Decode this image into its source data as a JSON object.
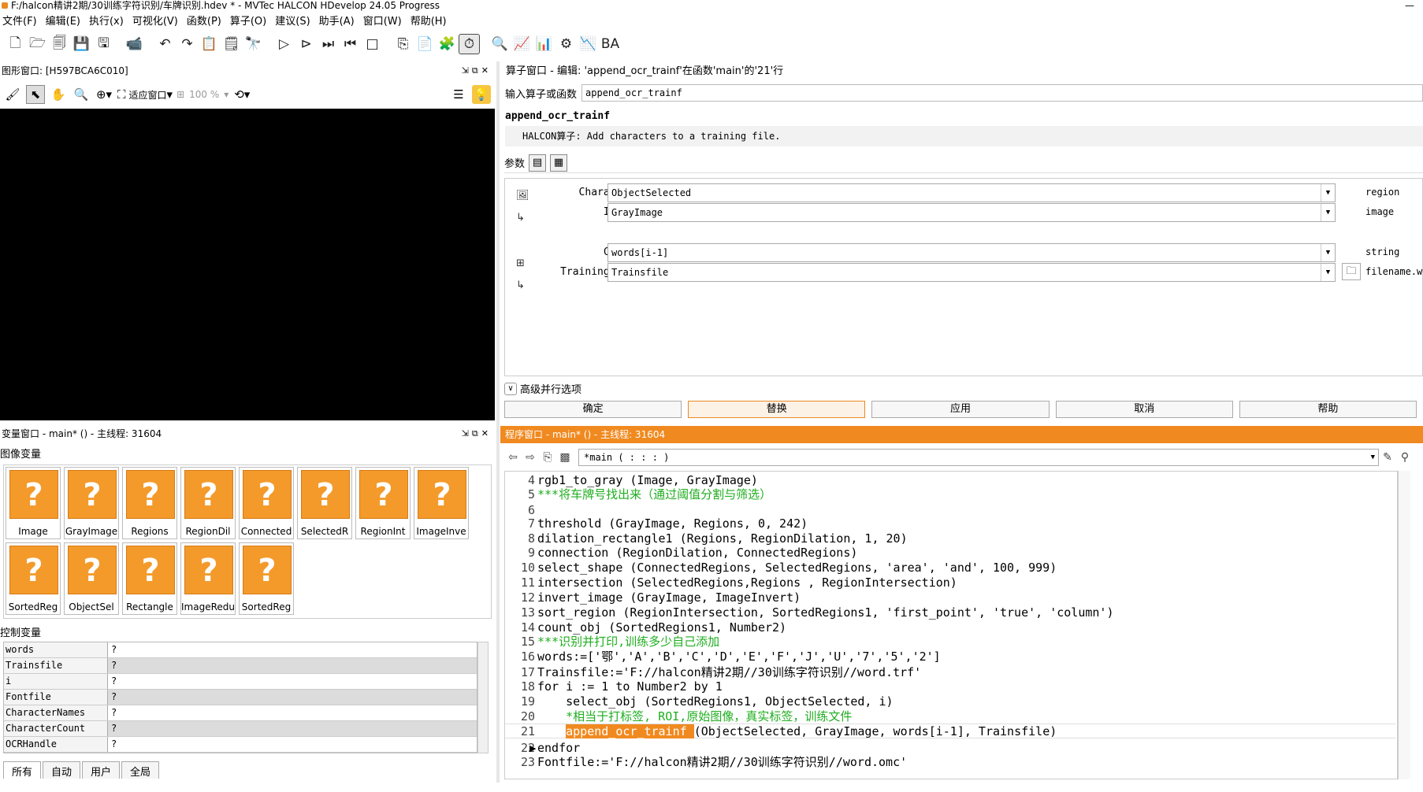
{
  "window": {
    "title": "F:/halcon精讲2期/30训练字符识别/车牌识别.hdev * - MVTec HALCON HDevelop 24.05 Progress",
    "minimize": "—"
  },
  "menu": [
    "文件(F)",
    "编辑(E)",
    "执行(x)",
    "可视化(V)",
    "函数(P)",
    "算子(O)",
    "建议(S)",
    "助手(A)",
    "窗口(W)",
    "帮助(H)"
  ],
  "graphics": {
    "header": "图形窗口: [H597BCA6C010]",
    "zoom_fit": "适应窗口",
    "zoom_pct": "100 %"
  },
  "variables": {
    "header": "变量窗口 - main* () - 主线程: 31604",
    "iconic_label": "图像变量",
    "iconic": [
      "Image",
      "GrayImage",
      "Regions",
      "RegionDil",
      "Connected",
      "SelectedR",
      "RegionInt",
      "ImageInve",
      "SortedReg",
      "ObjectSel",
      "Rectangle",
      "ImageRedu",
      "SortedReg"
    ],
    "thumb_glyph": "?",
    "control_label": "控制变量",
    "control": [
      {
        "name": "words",
        "value": "?"
      },
      {
        "name": "Trainsfile",
        "value": "?"
      },
      {
        "name": "i",
        "value": "?"
      },
      {
        "name": "Fontfile",
        "value": "?"
      },
      {
        "name": "CharacterNames",
        "value": "?"
      },
      {
        "name": "CharacterCount",
        "value": "?"
      },
      {
        "name": "OCRHandle",
        "value": "?"
      }
    ],
    "tabs": [
      "所有",
      "自动",
      "用户",
      "全局"
    ]
  },
  "operator": {
    "header": "算子窗口 - 编辑: 'append_ocr_trainf'在函数'main'的'21'行",
    "input_label": "输入算子或函数",
    "input_value": "append_ocr_trainf",
    "name": "append_ocr_trainf",
    "description": "HALCON算子:  Add characters to a training file.",
    "params_label": "参数",
    "params": [
      {
        "label": "Character",
        "value": "ObjectSelected",
        "type": "region"
      },
      {
        "label": "Image",
        "value": "GrayImage",
        "type": "image"
      },
      {
        "label": "Class",
        "value": "words[i-1]",
        "type": "string"
      },
      {
        "label": "TrainingFile",
        "value": "Trainsfile",
        "type": "filename.wr"
      }
    ],
    "advanced": "高级并行选项",
    "buttons": [
      "确定",
      "替换",
      "应用",
      "取消",
      "帮助"
    ]
  },
  "program": {
    "header": "程序窗口 - main* () - 主线程: 31604",
    "procedure": "*main ( : : : )",
    "lines": [
      {
        "n": "4",
        "code": "rgb1_to_gray (Image, GrayImage)",
        "type": "code"
      },
      {
        "n": "5",
        "code": "***将车牌号找出来（通过阈值分割与筛选）",
        "type": "comment"
      },
      {
        "n": "6",
        "code": "",
        "type": "code"
      },
      {
        "n": "7",
        "code": "threshold (GrayImage, Regions, 0, 242)",
        "type": "code"
      },
      {
        "n": "8",
        "code": "dilation_rectangle1 (Regions, RegionDilation, 1, 20)",
        "type": "code"
      },
      {
        "n": "9",
        "code": "connection (RegionDilation, ConnectedRegions)",
        "type": "code"
      },
      {
        "n": "10",
        "code": "select_shape (ConnectedRegions, SelectedRegions, 'area', 'and', 100, 999)",
        "type": "code"
      },
      {
        "n": "11",
        "code": "intersection (SelectedRegions,Regions , RegionIntersection)",
        "type": "code"
      },
      {
        "n": "12",
        "code": "invert_image (GrayImage, ImageInvert)",
        "type": "code"
      },
      {
        "n": "13",
        "code": "sort_region (RegionIntersection, SortedRegions1, 'first_point', 'true', 'column')",
        "type": "code"
      },
      {
        "n": "14",
        "code": "count_obj (SortedRegions1, Number2)",
        "type": "code"
      },
      {
        "n": "15",
        "code": "***识别并打印,训练多少自己添加",
        "type": "comment"
      },
      {
        "n": "16",
        "code": "words:=['鄂','A','B','C','D','E','F','J','U','7','5','2']",
        "type": "code"
      },
      {
        "n": "17",
        "code": "Trainsfile:='F://halcon精讲2期//30训练字符识别//word.trf'",
        "type": "code"
      },
      {
        "n": "18",
        "code": "for i := 1 to Number2 by 1",
        "type": "code"
      },
      {
        "n": "19",
        "code": "    select_obj (SortedRegions1, ObjectSelected, i)",
        "type": "code"
      },
      {
        "n": "20",
        "code": "    *相当于打标签, ROI,原始图像，真实标签，训练文件",
        "type": "comment"
      },
      {
        "n": "21",
        "code": "(ObjectSelected, GrayImage, words[i-1], Trainsfile)",
        "type": "current",
        "prefix": "    ",
        "highlight": "append_ocr_trainf "
      },
      {
        "n": "22",
        "code": "endfor",
        "type": "code"
      },
      {
        "n": "23",
        "code": "Fontfile:='F://halcon精讲2期//30训练字符识别//word.omc'",
        "type": "code"
      }
    ]
  }
}
